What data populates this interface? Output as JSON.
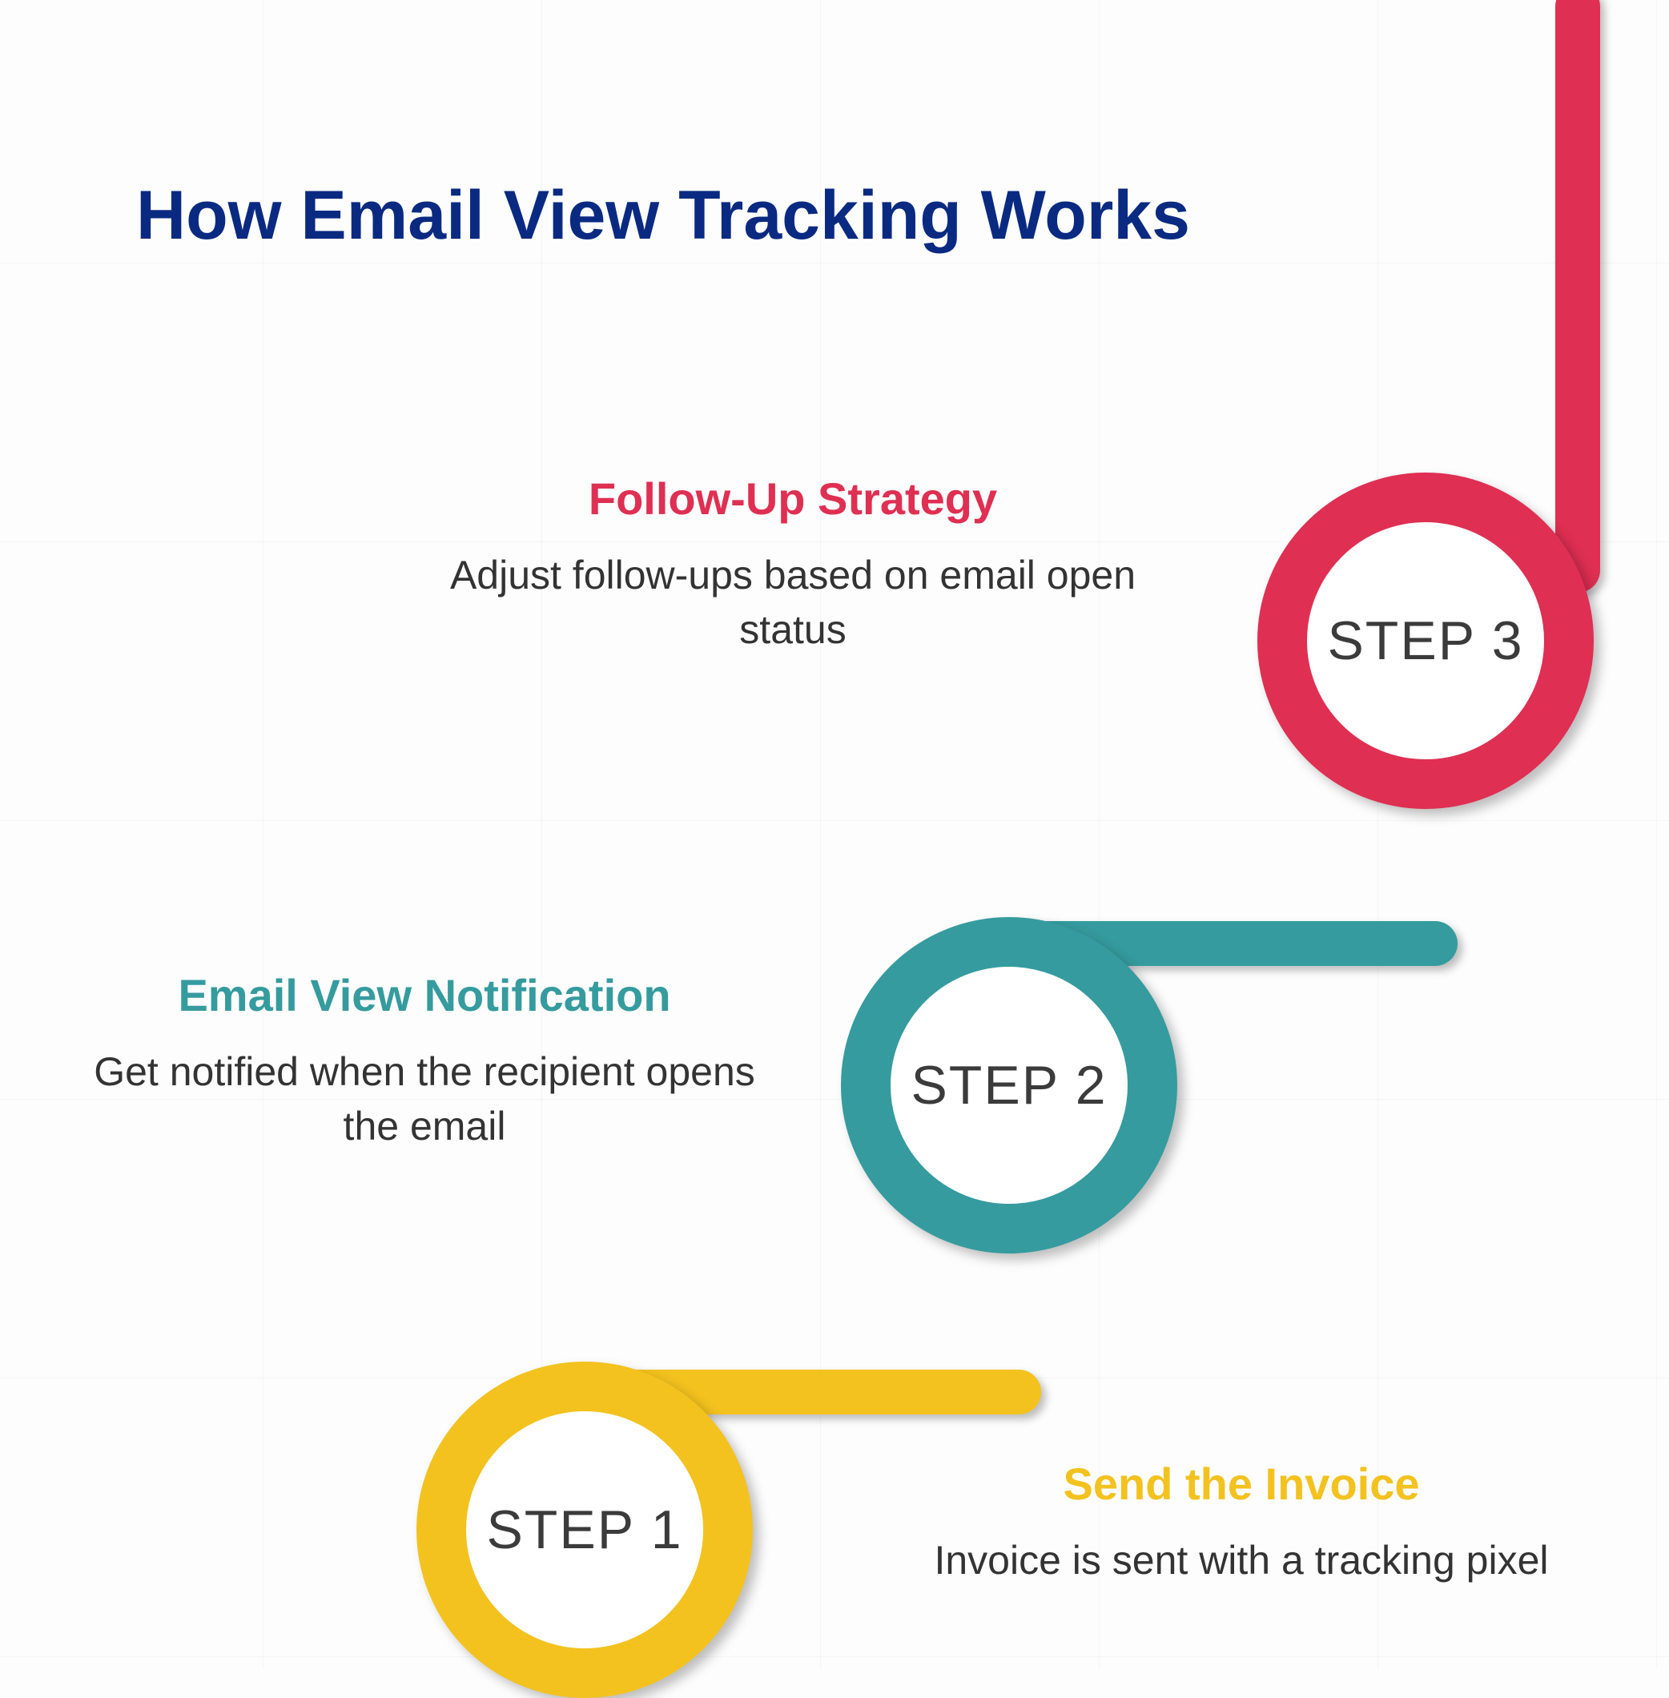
{
  "title": "How Email View Tracking Works",
  "steps": {
    "step1": {
      "label": "STEP 1",
      "heading": "Send the Invoice",
      "description": "Invoice is sent with a tracking pixel",
      "color": "#f3c21f"
    },
    "step2": {
      "label": "STEP 2",
      "heading": "Email View Notification",
      "description": "Get notified when the recipient opens the email",
      "color": "#359b9e"
    },
    "step3": {
      "label": "STEP 3",
      "heading": "Follow-Up Strategy",
      "description": "Adjust follow-ups based on email open status",
      "color": "#df2f52"
    }
  }
}
